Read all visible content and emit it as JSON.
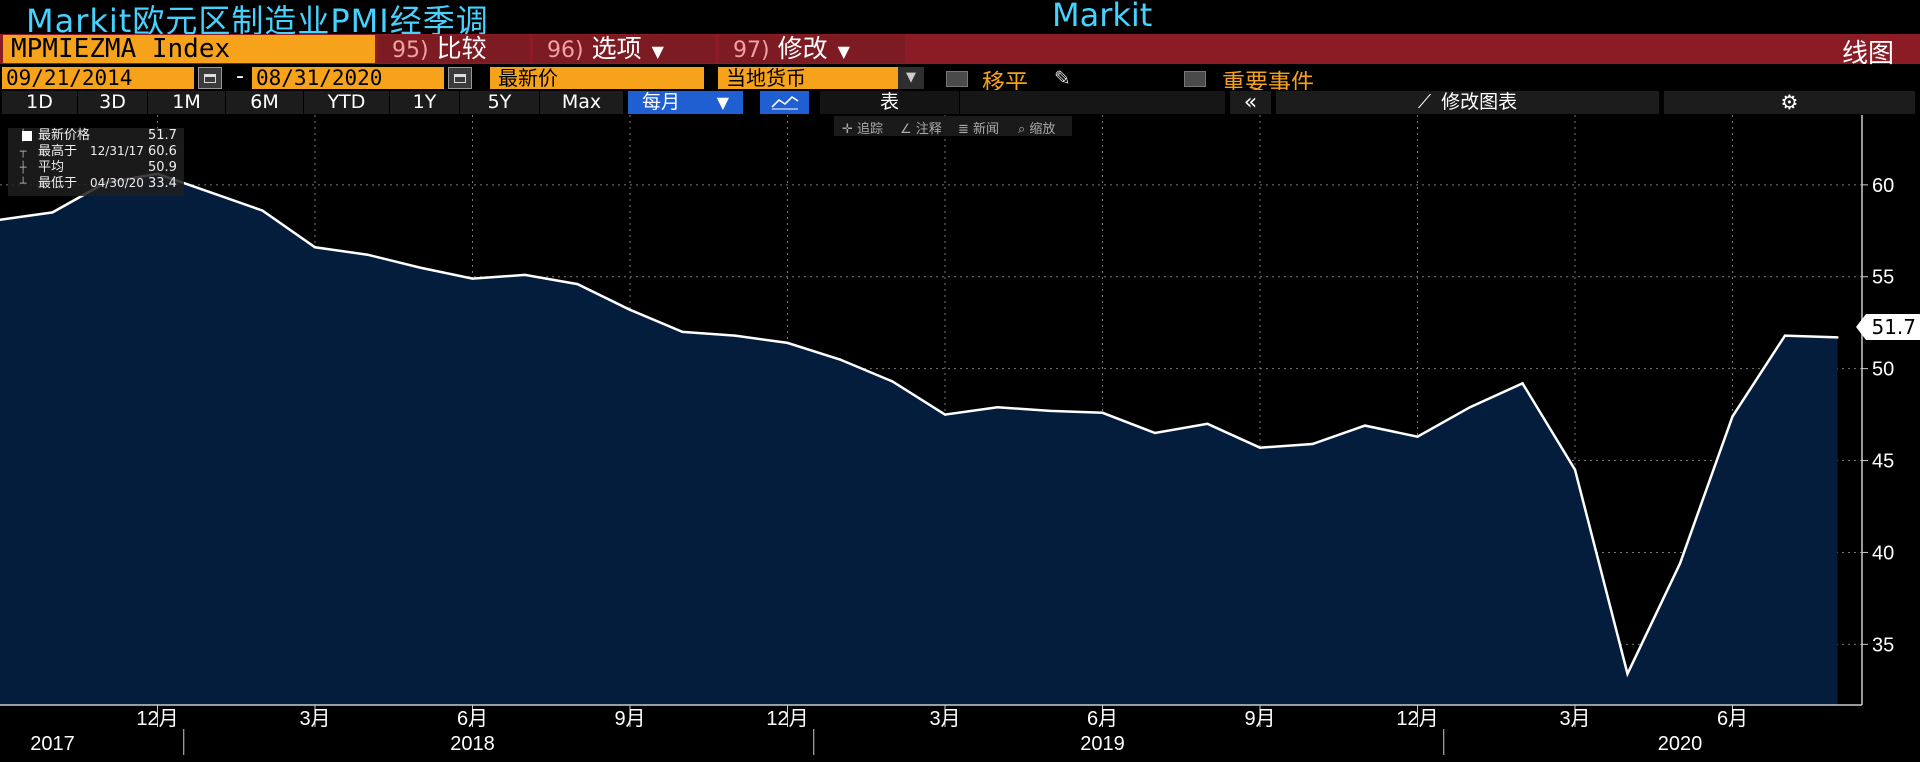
{
  "header": {
    "title": "Markit欧元区制造业PMI经季调",
    "source": "Markit",
    "chart_type_label": "线图"
  },
  "toolbar": {
    "ticker": "MPMIEZMA Index",
    "menus": [
      {
        "num": "95)",
        "label": "比较",
        "caret": false
      },
      {
        "num": "96)",
        "label": "选项",
        "caret": true
      },
      {
        "num": "97)",
        "label": "修改",
        "caret": true
      }
    ],
    "start_date": "09/21/2014",
    "date_sep": "-",
    "end_date": "08/31/2020",
    "price_field": "最新价",
    "currency_field": "当地货币",
    "moving_avg_label": "移平",
    "events_label": "重要事件",
    "periods": [
      "1D",
      "3D",
      "1M",
      "6M",
      "YTD",
      "1Y",
      "5Y",
      "Max"
    ],
    "frequency": "每月",
    "table_label": "表",
    "collapse_label": "«",
    "edit_chart_label": "修改图表",
    "colors": {
      "orange": "#f7a21b",
      "menu": "#7d1b22",
      "bar": "#8b1c25",
      "blue": "#1f5fd1",
      "title": "#46d2ff"
    }
  },
  "legend": {
    "rows": [
      {
        "label": "最新价格",
        "date": "",
        "value": "51.7"
      },
      {
        "label": "最高于",
        "date": "12/31/17",
        "value": "60.6"
      },
      {
        "label": "平均",
        "date": "",
        "value": "50.9"
      },
      {
        "label": "最低于",
        "date": "04/30/20",
        "value": "33.4"
      }
    ]
  },
  "hints": [
    "追踪",
    "注释",
    "新闻",
    "缩放"
  ],
  "last_value_label": "51.7",
  "chart_data": {
    "type": "area",
    "title": "Markit欧元区制造业PMI经季调",
    "ylim": [
      31.7,
      63.8
    ],
    "y_ticks": [
      35,
      40,
      45,
      50,
      55,
      60
    ],
    "x_tick_labels": [
      "12月",
      "3月",
      "6月",
      "9月",
      "12月",
      "3月",
      "6月",
      "9月",
      "12月",
      "3月",
      "6月"
    ],
    "x_tick_dates": [
      "2017-12",
      "2018-03",
      "2018-06",
      "2018-09",
      "2018-12",
      "2019-03",
      "2019-06",
      "2019-09",
      "2019-12",
      "2020-03",
      "2020-06"
    ],
    "year_labels": [
      "2017",
      "2018",
      "2019",
      "2020"
    ],
    "year_label_dates": [
      "2017-10",
      "2018-06",
      "2019-06",
      "2020-05"
    ],
    "grid": true,
    "series": [
      {
        "x": [
          "2017-09",
          "2017-10",
          "2017-11",
          "2017-12",
          "2018-01",
          "2018-02",
          "2018-03",
          "2018-04",
          "2018-05",
          "2018-06",
          "2018-07",
          "2018-08",
          "2018-09",
          "2018-10",
          "2018-11",
          "2018-12",
          "2019-01",
          "2019-02",
          "2019-03",
          "2019-04",
          "2019-05",
          "2019-06",
          "2019-07",
          "2019-08",
          "2019-09",
          "2019-10",
          "2019-11",
          "2019-12",
          "2020-01",
          "2020-02",
          "2020-03",
          "2020-04",
          "2020-05",
          "2020-06",
          "2020-07",
          "2020-08"
        ],
        "values": [
          58.1,
          58.5,
          60.1,
          60.6,
          59.6,
          58.6,
          56.6,
          56.2,
          55.5,
          54.9,
          55.1,
          54.6,
          53.2,
          52.0,
          51.8,
          51.4,
          50.5,
          49.3,
          47.5,
          47.9,
          47.7,
          47.6,
          46.5,
          47.0,
          45.7,
          45.9,
          46.9,
          46.3,
          47.9,
          49.2,
          44.5,
          33.4,
          39.4,
          47.4,
          51.8,
          51.7
        ]
      }
    ],
    "colors": {
      "fill": "#041d3d",
      "line": "#ffffff",
      "background": "#000000",
      "grid": "#777777"
    }
  }
}
